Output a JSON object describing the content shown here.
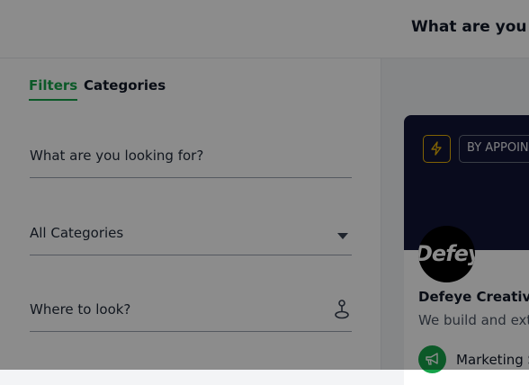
{
  "header": {
    "search_prompt": "What are you lo"
  },
  "sidebar": {
    "tabs": [
      {
        "label": "Filters",
        "active": true
      },
      {
        "label": "Categories",
        "active": false
      }
    ],
    "search_placeholder": "What are you looking for?",
    "category_select": "All Categories",
    "location_placeholder": "Where to look?"
  },
  "listing": {
    "badge": "BY APPOIN",
    "logo_text": "Defeye",
    "title": "Defeye Creative",
    "description": "We build and ext",
    "category": "Marketing S"
  },
  "colors": {
    "accent": "#16a34a",
    "banner": "#121435",
    "bolt": "#eab308"
  },
  "icons": [
    "lightning-bolt-icon",
    "caret-down-icon",
    "location-pin-icon",
    "megaphone-icon"
  ]
}
